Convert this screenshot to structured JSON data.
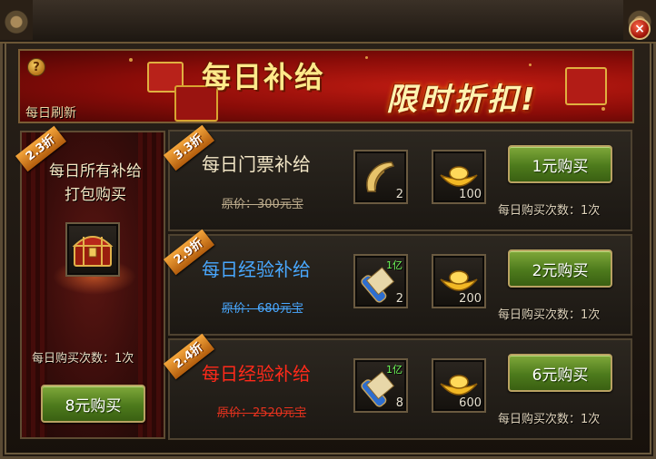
{
  "banner": {
    "title": "每日补给",
    "subtitle": "限时折扣!",
    "refresh_label": "每日刷新",
    "help_label": "?"
  },
  "close_label": "×",
  "bundle": {
    "discount": "2.3折",
    "title_line1": "每日所有补给",
    "title_line2": "打包购买",
    "item_icon": "treasure-chest-icon",
    "limit_text": "每日购买次数：1次",
    "buy_label": "8元购买"
  },
  "offers": [
    {
      "discount": "3.3折",
      "name": "每日门票补给",
      "name_color": "#f2e6c6",
      "original_price": "原价：300元宝",
      "price_color": "#bfae8e",
      "items": [
        {
          "icon": "ticket-scroll-icon",
          "count": "2",
          "tag": ""
        },
        {
          "icon": "gold-ingot-icon",
          "count": "100",
          "tag": ""
        }
      ],
      "buy_label": "1元购买",
      "limit_text": "每日购买次数：1次"
    },
    {
      "discount": "2.9折",
      "name": "每日经验补给",
      "name_color": "#49a8ff",
      "original_price": "原价：680元宝",
      "price_color": "#49a8ff",
      "items": [
        {
          "icon": "exp-scroll-icon",
          "count": "2",
          "tag": "1亿"
        },
        {
          "icon": "gold-ingot-icon",
          "count": "200",
          "tag": ""
        }
      ],
      "buy_label": "2元购买",
      "limit_text": "每日购买次数：1次"
    },
    {
      "discount": "2.4折",
      "name": "每日经验补给",
      "name_color": "#ff2a1a",
      "original_price": "原价：2520元宝",
      "price_color": "#e5321e",
      "items": [
        {
          "icon": "exp-scroll-icon",
          "count": "8",
          "tag": "1亿"
        },
        {
          "icon": "gold-ingot-icon",
          "count": "600",
          "tag": ""
        }
      ],
      "buy_label": "6元购买",
      "limit_text": "每日购买次数：1次"
    }
  ]
}
